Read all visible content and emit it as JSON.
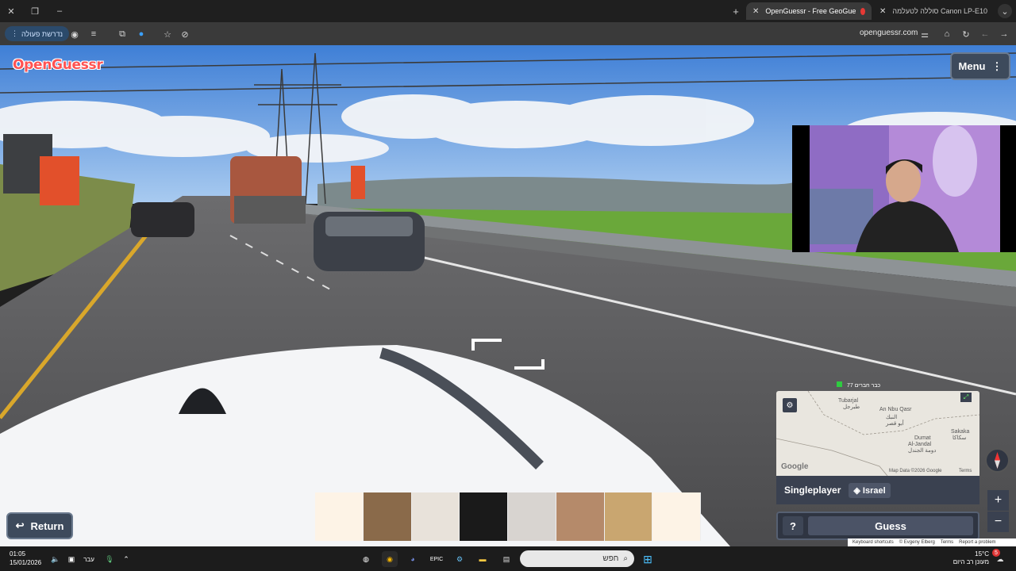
{
  "browser": {
    "tabs": [
      {
        "title": "OpenGuessr - Free GeoGue",
        "active": true
      },
      {
        "title": "סוללה לטעלמה Canon LP-E10",
        "active": false
      }
    ],
    "update_label": "נדרשת פעולה",
    "url": "openguessr.com"
  },
  "game": {
    "logo": "OpenGuessr",
    "menu_label": "Menu",
    "return_label": "Return",
    "mode": "Singleplayer",
    "country": "Israel",
    "guess_label": "Guess",
    "help_label": "?"
  },
  "minimap": {
    "labels": [
      "Tubarjal",
      "طبرجل",
      "An Nbu Qasr",
      "النبك",
      "أبو قصر",
      "Sakaka",
      "سكاكا",
      "Dumat",
      "Al-Jandal",
      "دومة الجندل"
    ],
    "credit": "Map Data ©2026 Google",
    "terms": "Terms",
    "google": "Google"
  },
  "overlay_text": "77 כבר חברים",
  "attribution": [
    "Keyboard shortcuts",
    "© Evgeny Elberg",
    "Terms",
    "Report a problem"
  ],
  "taskbar": {
    "time": "01:05",
    "date": "15/01/2026",
    "lang": "עבר",
    "search_placeholder": "חפש",
    "weather_temp": "15°C",
    "weather_desc": "מעונן רב היום",
    "notif_count": "5"
  }
}
